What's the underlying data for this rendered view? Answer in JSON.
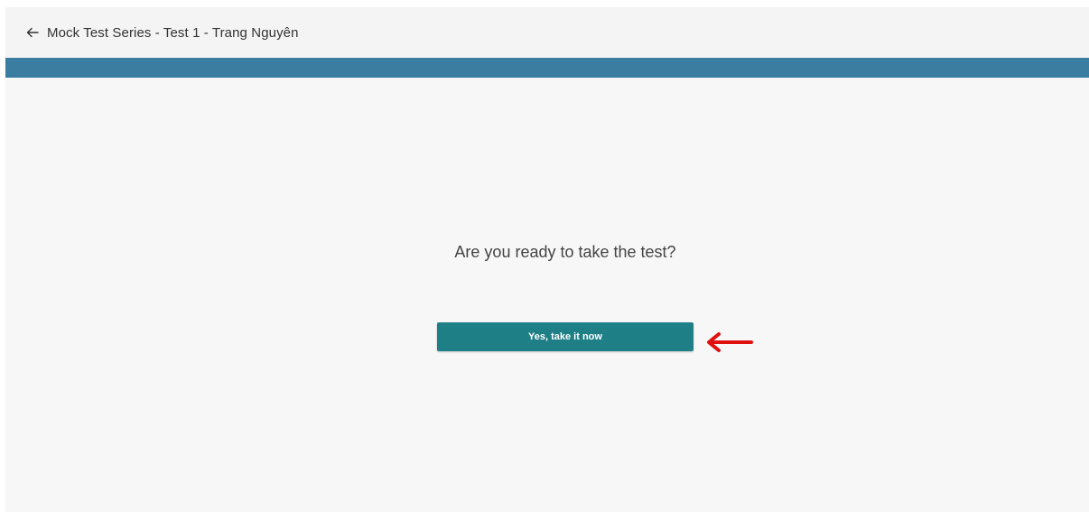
{
  "header": {
    "back_icon": "arrow-left-icon",
    "title": "Mock Test Series - Test 1 - Trang Nguyên"
  },
  "colors": {
    "accent_bar": "#3a7da0",
    "button_bg": "#1f7f86",
    "annotation_arrow": "#e01010"
  },
  "main": {
    "prompt": "Are you ready to take the test?",
    "start_button_label": "Yes, take it now"
  },
  "annotation": {
    "icon": "arrow-left-icon"
  }
}
